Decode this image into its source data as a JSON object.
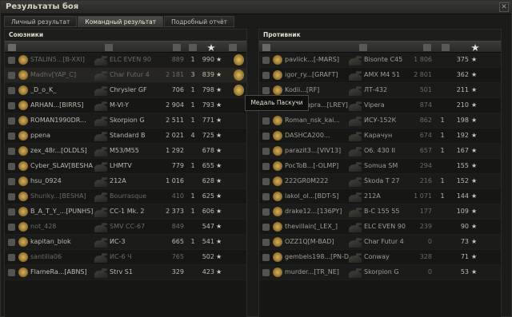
{
  "window": {
    "title": "Результаты боя",
    "close_glyph": "✕"
  },
  "tabs": [
    {
      "label": "Личный результат",
      "active": false
    },
    {
      "label": "Командный результат",
      "active": true
    },
    {
      "label": "Подробный отчёт",
      "active": false
    }
  ],
  "allies": {
    "title": "Союзники",
    "rows": [
      {
        "player": "STALIN5...[B-XXI]",
        "tank": "ELC EVEN 90",
        "damage": "889",
        "kills": "1",
        "xp": "990",
        "medal": true,
        "alive": false
      },
      {
        "player": "Madhv[YAP_C]",
        "tank": "Char Futur 4",
        "damage": "2 181",
        "kills": "3",
        "xp": "839",
        "medal": true,
        "alive": false
      },
      {
        "player": "_D_o_K_",
        "tank": "Chrysler GF",
        "damage": "706",
        "kills": "1",
        "xp": "798",
        "medal": true,
        "alive": true
      },
      {
        "player": "ARHAN...[BIRRS]",
        "tank": "M-VI-Y",
        "damage": "2 904",
        "kills": "1",
        "xp": "793",
        "medal": false,
        "alive": true
      },
      {
        "player": "ROMAN1990DR...",
        "tank": "Skorpion G",
        "damage": "2 511",
        "kills": "1",
        "xp": "771",
        "medal": false,
        "alive": true
      },
      {
        "player": "ppena",
        "tank": "Standard B",
        "damage": "2 021",
        "kills": "4",
        "xp": "725",
        "medal": false,
        "alive": true
      },
      {
        "player": "zex_48r...[OLDLS]",
        "tank": "M53/M55",
        "damage": "1 292",
        "kills": "",
        "xp": "678",
        "medal": false,
        "alive": true
      },
      {
        "player": "Cyber_SLAV[BESHA]",
        "tank": "LHMTV",
        "damage": "779",
        "kills": "1",
        "xp": "655",
        "medal": false,
        "alive": true
      },
      {
        "player": "hsu_0924",
        "tank": "212A",
        "damage": "1 016",
        "kills": "",
        "xp": "628",
        "medal": false,
        "alive": true
      },
      {
        "player": "Shuriky...[BESHA]",
        "tank": "Bourrasque",
        "damage": "410",
        "kills": "1",
        "xp": "625",
        "medal": false,
        "alive": false
      },
      {
        "player": "B_A_T_Y_...[PUNHS]",
        "tank": "СС-1 Mk. 2",
        "damage": "2 373",
        "kills": "1",
        "xp": "606",
        "medal": false,
        "alive": true
      },
      {
        "player": "not_428",
        "tank": "SMV CC-67",
        "damage": "849",
        "kills": "",
        "xp": "547",
        "medal": false,
        "alive": false
      },
      {
        "player": "kapitan_blok",
        "tank": "ИС-3",
        "damage": "665",
        "kills": "1",
        "xp": "541",
        "medal": false,
        "alive": true
      },
      {
        "player": "santilla06",
        "tank": "ИС-6 Ч",
        "damage": "765",
        "kills": "",
        "xp": "502",
        "medal": false,
        "alive": false
      },
      {
        "player": "FlameRa...[ABNS]",
        "tank": "Strv S1",
        "damage": "329",
        "kills": "",
        "xp": "423",
        "medal": false,
        "alive": true
      }
    ]
  },
  "enemies": {
    "title": "Противник",
    "rows": [
      {
        "player": "pavlick...[-MARS]",
        "tank": "Bisonte C45",
        "damage": "1 806",
        "kills": "",
        "xp": "375"
      },
      {
        "player": "igor_ry...[GRAFT]",
        "tank": "AMX M4 51",
        "damage": "2 801",
        "kills": "",
        "xp": "362"
      },
      {
        "player": "Kodii...[RF]",
        "tank": "ЛТ-432",
        "damage": "501",
        "kills": "",
        "xp": "211"
      },
      {
        "player": "Tolly_Supra...[LREY]",
        "tank": "Vipera",
        "damage": "874",
        "kills": "",
        "xp": "210"
      },
      {
        "player": "Roman_nsk_kai...",
        "tank": "ИСУ-152К",
        "damage": "862",
        "kills": "1",
        "xp": "198"
      },
      {
        "player": "DASHCA200...",
        "tank": "Карачун",
        "damage": "674",
        "kills": "1",
        "xp": "192"
      },
      {
        "player": "parazit3...[VIV13]",
        "tank": "O6. 430 II",
        "damage": "657",
        "kills": "1",
        "xp": "167"
      },
      {
        "player": "PocToB...[-OLMP]",
        "tank": "Somua SM",
        "damage": "294",
        "kills": "",
        "xp": "155"
      },
      {
        "player": "222GR0M222",
        "tank": "Škoda T 27",
        "damage": "216",
        "kills": "1",
        "xp": "152"
      },
      {
        "player": "lakol_ol...[BDT-S]",
        "tank": "212A",
        "damage": "1 071",
        "kills": "1",
        "xp": "144"
      },
      {
        "player": "drake12...[136PY]",
        "tank": "B-C 155 55",
        "damage": "177",
        "kills": "",
        "xp": "109"
      },
      {
        "player": "thevillain[_LEX_]",
        "tank": "ELC EVEN 90",
        "damage": "239",
        "kills": "",
        "xp": "90"
      },
      {
        "player": "OZZ1Q[M-BAD]",
        "tank": "Char Futur 4",
        "damage": "0",
        "kills": "",
        "xp": "73"
      },
      {
        "player": "gembels198...[PN-DA]",
        "tank": "Conway",
        "damage": "328",
        "kills": "",
        "xp": "71"
      },
      {
        "player": "murder...[TR_NE]",
        "tank": "Skorpion G",
        "damage": "0",
        "kills": "",
        "xp": "53"
      }
    ]
  },
  "tooltip": {
    "text": "Медаль Паскучи"
  },
  "icons": {
    "star": "star-icon",
    "medal": "medal-icon",
    "close": "close-icon",
    "platoon": "platoon-icon",
    "clan": "clan-emblem-icon",
    "tank": "tank-icon"
  },
  "colors": {
    "accent": "#d8b25a",
    "background": "#1b1b1a",
    "text": "#bdb9ae",
    "dead_text": "#6c6a63"
  }
}
